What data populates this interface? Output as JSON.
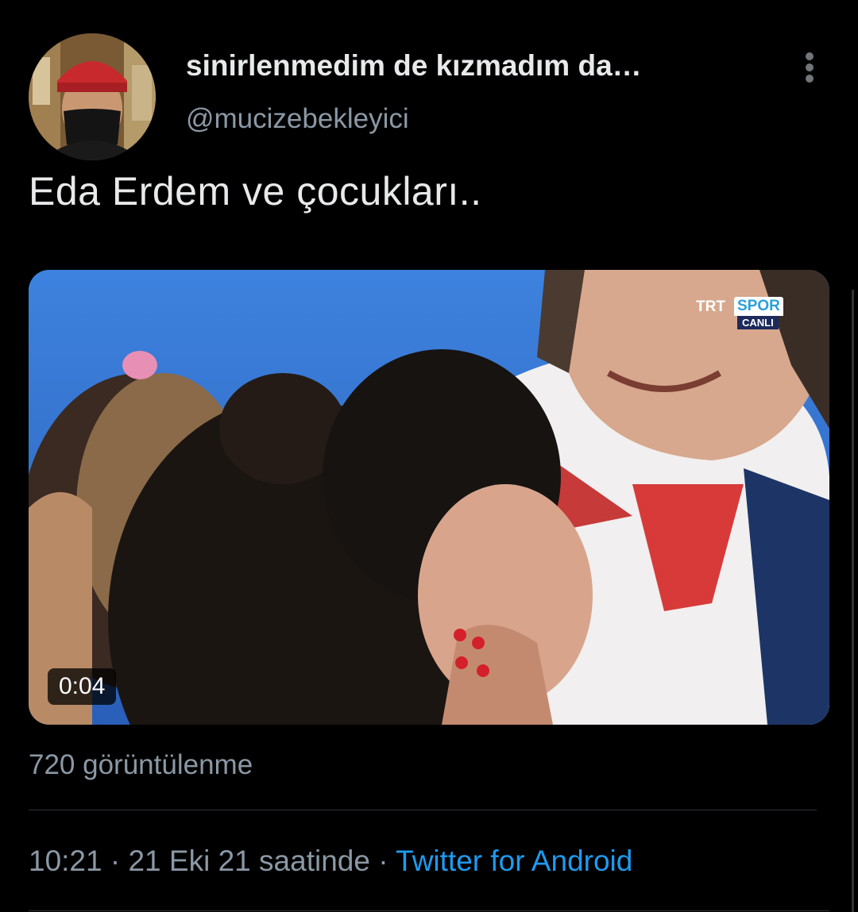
{
  "author": {
    "display_name": "sinirlenmedim de kızmadım da…",
    "handle": "@mucizebekleyici",
    "avatar_icon": "profile-photo"
  },
  "more_icon": "more-vertical-icon",
  "tweet": {
    "text": "Eda Erdem ve çocukları.."
  },
  "media": {
    "type": "video",
    "duration": "0:04",
    "broadcaster": {
      "name": "TRT",
      "channel": "SPOR",
      "live_label": "CANLI"
    }
  },
  "stats": {
    "views": "720 görüntülenme"
  },
  "meta": {
    "time": "10:21",
    "separator": "·",
    "date": "21 Eki 21 saatinde",
    "source": "Twitter for Android"
  },
  "colors": {
    "background": "#000000",
    "primary_text": "#e7e9ea",
    "secondary_text": "#8b98a5",
    "link": "#1d9bf0",
    "divider": "#2f3336"
  }
}
